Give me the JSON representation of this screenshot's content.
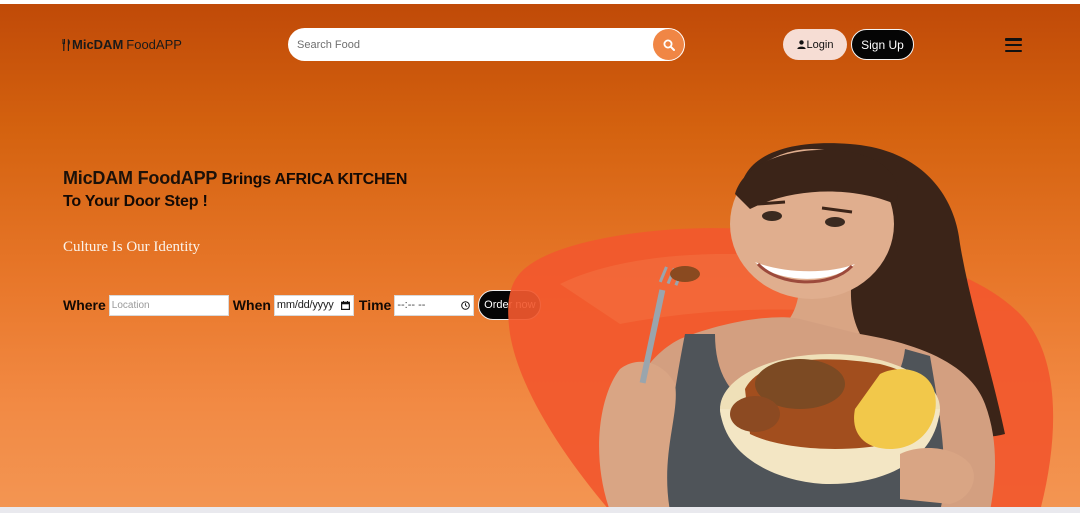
{
  "header": {
    "brand_strong": "MicDAM",
    "brand_light": "FoodAPP",
    "search_placeholder": "Search Food",
    "login_label": "Login",
    "signup_label": "Sign Up"
  },
  "hero": {
    "headline_brand": "MicDAM FoodAPP",
    "headline_rest": " Brings AFRICA KITCHEN",
    "headline_line2": "To Your Door Step !",
    "tagline": "Culture Is Our Identity"
  },
  "order_form": {
    "where_label": "Where",
    "location_placeholder": "Location",
    "when_label": "When",
    "date_value": "mm/dd/yyyy",
    "time_label": "Time",
    "time_value": "--:-- --",
    "order_button": "Order now"
  },
  "icons": {
    "logo": "fork-knife-icon",
    "search": "search-icon",
    "login": "user-icon",
    "menu": "hamburger-menu-icon",
    "calendar": "calendar-icon",
    "clock": "clock-icon"
  },
  "colors": {
    "header_gradient_top": "#c04a08",
    "hero_gradient_bottom": "#f39552",
    "search_button": "#f08645",
    "login_button": "#f6ddd4",
    "dark_button": "#050505",
    "tagline": "#fbf3ea"
  }
}
